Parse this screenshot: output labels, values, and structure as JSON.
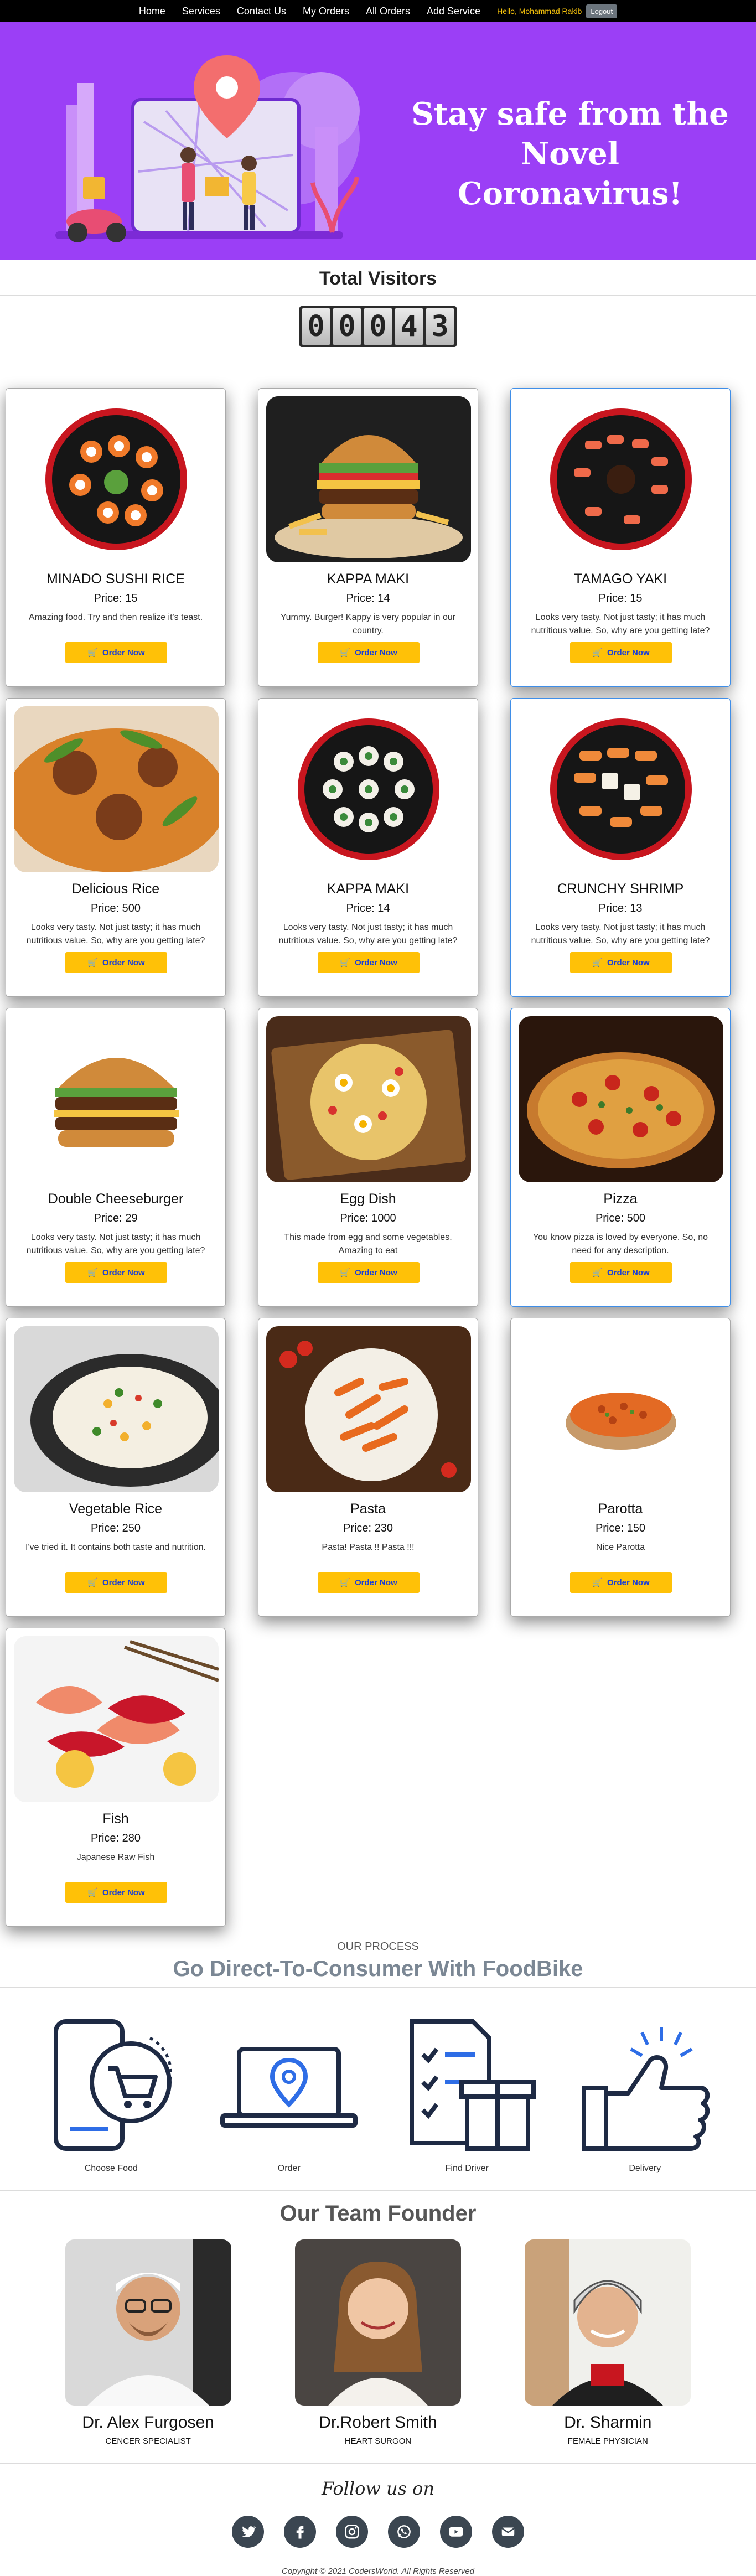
{
  "nav": {
    "links": [
      "Home",
      "Services",
      "Contact Us",
      "My Orders",
      "All Orders",
      "Add Service"
    ],
    "greeting": "Hello, Mohammad Rakib",
    "logout": "Logout"
  },
  "hero": {
    "title": "Stay safe from the Novel Coronavirus!",
    "bg_color": "#9b3ff6"
  },
  "visitors": {
    "title": "Total Visitors",
    "digits": [
      "0",
      "0",
      "0",
      "4",
      "3"
    ]
  },
  "products": {
    "order_label": "Order Now",
    "accent": "#ffc107",
    "items": [
      {
        "name": "MINADO SUSHI RICE",
        "price": "Price: 15",
        "desc": "Amazing food. Try and then realize it's teast."
      },
      {
        "name": "KAPPA MAKI",
        "price": "Price: 14",
        "desc": "Yummy. Burger! Kappy is very popular in our country."
      },
      {
        "name": "TAMAGO YAKI",
        "price": "Price: 15",
        "desc": "Looks very tasty. Not just tasty; it has much nutritious value. So, why are you getting late?"
      },
      {
        "name": "Delicious Rice",
        "price": "Price: 500",
        "desc": "Looks very tasty. Not just tasty; it has much nutritious value. So, why are you getting late?"
      },
      {
        "name": "KAPPA MAKI",
        "price": "Price: 14",
        "desc": "Looks very tasty. Not just tasty; it has much nutritious value. So, why are you getting late?"
      },
      {
        "name": "CRUNCHY SHRIMP",
        "price": "Price: 13",
        "desc": "Looks very tasty. Not just tasty; it has much nutritious value. So, why are you getting late?"
      },
      {
        "name": "Double Cheeseburger",
        "price": "Price: 29",
        "desc": "Looks very tasty. Not just tasty; it has much nutritious value. So, why are you getting late?"
      },
      {
        "name": "Egg Dish",
        "price": "Price: 1000",
        "desc": "This made from egg and some vegetables. Amazing to eat"
      },
      {
        "name": "Pizza",
        "price": "Price: 500",
        "desc": "You know pizza is loved by everyone. So, no need for any description."
      },
      {
        "name": "Vegetable Rice",
        "price": "Price: 250",
        "desc": "I've tried it. It contains both taste and nutrition."
      },
      {
        "name": "Pasta",
        "price": "Price: 230",
        "desc": "Pasta! Pasta !! Pasta !!!"
      },
      {
        "name": "Parotta",
        "price": "Price: 150",
        "desc": "Nice Parotta"
      },
      {
        "name": "Fish",
        "price": "Price: 280",
        "desc": "Japanese Raw Fish"
      }
    ]
  },
  "process": {
    "eyebrow": "OUR PROCESS",
    "title": "Go Direct-To-Consumer With FoodBike",
    "steps": [
      "Choose Food",
      "Order",
      "Find Driver",
      "Delivery"
    ]
  },
  "team": {
    "title": "Our Team Founder",
    "members": [
      {
        "name": "Dr. Alex Furgosen",
        "role": "CENCER SPECIALIST"
      },
      {
        "name": "Dr.Robert Smith",
        "role": "HEART SURGON"
      },
      {
        "name": "Dr. Sharmin",
        "role": "FEMALE PHYSICIAN"
      }
    ]
  },
  "footer": {
    "follow": "Follow us on",
    "copyright": "Copyright © 2021 CodersWorld. All Rights Reserved",
    "social_icons": [
      "twitter-icon",
      "facebook-icon",
      "instagram-icon",
      "whatsapp-icon",
      "youtube-icon",
      "email-icon"
    ]
  }
}
